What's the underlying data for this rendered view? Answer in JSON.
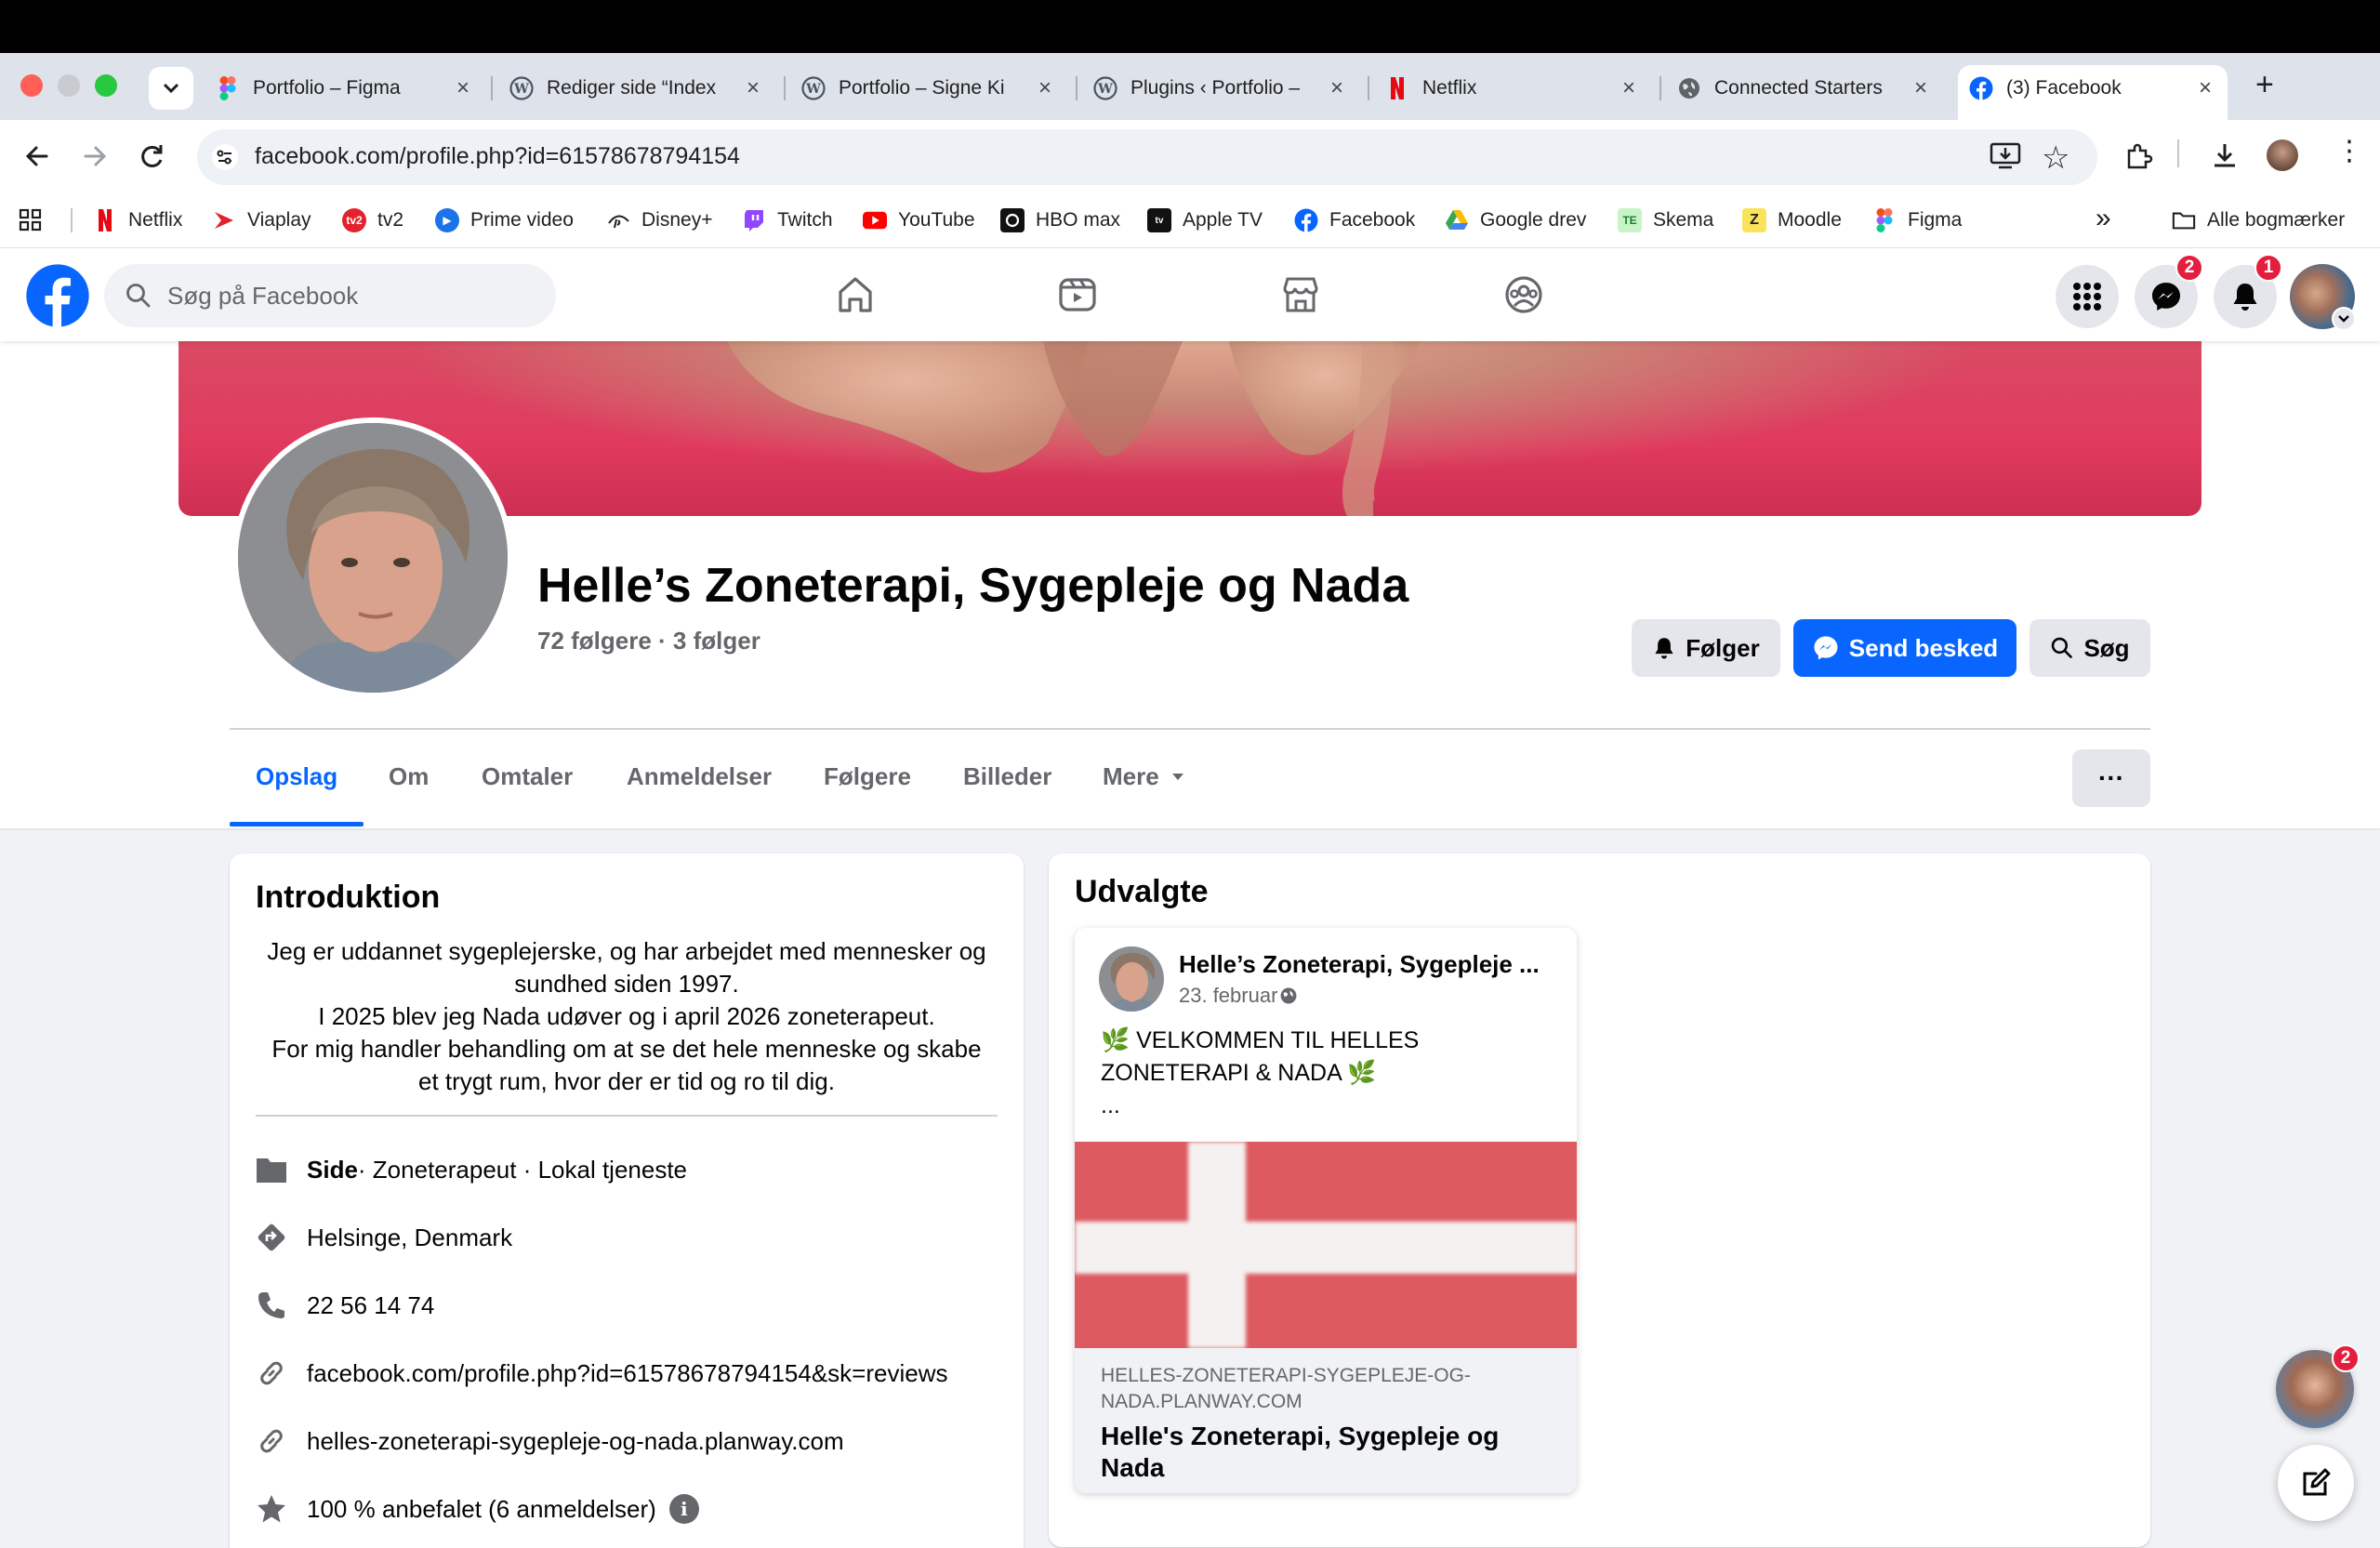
{
  "browser": {
    "tabs": [
      {
        "title": "Portfolio – Figma",
        "icon": "figma-icon"
      },
      {
        "title": "Rediger side “Index",
        "icon": "wordpress-icon"
      },
      {
        "title": "Portfolio – Signe Ki",
        "icon": "wordpress-icon"
      },
      {
        "title": "Plugins ‹ Portfolio –",
        "icon": "wordpress-icon"
      },
      {
        "title": "Netflix",
        "icon": "netflix-icon"
      },
      {
        "title": "Connected Starters",
        "icon": "globe-icon"
      },
      {
        "title": "(3) Facebook",
        "icon": "facebook-icon",
        "active": true
      }
    ],
    "url": "facebook.com/profile.php?id=61578678794154",
    "bookmarks": [
      {
        "label": "Netflix",
        "icon": "netflix-icon"
      },
      {
        "label": "Viaplay",
        "icon": "viaplay-icon"
      },
      {
        "label": "tv2",
        "icon": "tv2-icon"
      },
      {
        "label": "Prime video",
        "icon": "prime-video-icon"
      },
      {
        "label": "Disney+",
        "icon": "disney-icon"
      },
      {
        "label": "Twitch",
        "icon": "twitch-icon"
      },
      {
        "label": "YouTube",
        "icon": "youtube-icon"
      },
      {
        "label": "HBO max",
        "icon": "hbo-icon"
      },
      {
        "label": "Apple TV",
        "icon": "apple-tv-icon"
      },
      {
        "label": "Facebook",
        "icon": "facebook-icon"
      },
      {
        "label": "Google drev",
        "icon": "google-drive-icon"
      },
      {
        "label": "Skema",
        "icon": "skema-icon"
      },
      {
        "label": "Moodle",
        "icon": "moodle-icon"
      },
      {
        "label": "Figma",
        "icon": "figma-icon"
      }
    ],
    "all_bookmarks": "Alle bogmærker",
    "overflow": "»"
  },
  "fb": {
    "search_placeholder": "Søg på Facebook",
    "messenger_badge": "2",
    "notifications_badge": "1",
    "chat_badge": "2",
    "brand_color": "#0866ff"
  },
  "profile": {
    "name": "Helle’s Zoneterapi, Sygepleje og Nada",
    "stats": "72 følgere · 3 følger",
    "buttons": {
      "follow": "Følger",
      "message": "Send besked",
      "search": "Søg"
    },
    "tabs": [
      "Opslag",
      "Om",
      "Omtaler",
      "Anmeldelser",
      "Følgere",
      "Billeder",
      "Mere"
    ],
    "more_menu": "···"
  },
  "intro": {
    "title": "Introduktion",
    "bio_lines": [
      "Jeg er uddannet sygeplejerske, og har arbejdet med mennesker og",
      "sundhed siden 1997.",
      "I 2025 blev jeg Nada udøver og i april 2026 zoneterapeut.",
      "For mig handler behandling om at se det hele menneske og skabe",
      "et trygt rum, hvor der er tid og ro til dig."
    ],
    "page_type_bold": "Side",
    "page_type_rest": " · Zoneterapeut · Lokal tjeneste",
    "location": "Helsinge, Denmark",
    "phone": "22 56 14 74",
    "reviews_link": "facebook.com/profile.php?id=61578678794154&sk=reviews",
    "website": "helles-zoneterapi-sygepleje-og-nada.planway.com",
    "rating": "100 % anbefalet (6 anmeldelser)"
  },
  "featured": {
    "title": "Udvalgte",
    "post": {
      "author": "Helle’s Zoneterapi, Sygepleje ...",
      "date": "23. februar",
      "text_line1": "🌿 VELKOMMEN TIL HELLES",
      "text_line2": "ZONETERAPI & NADA 🌿",
      "ellipsis": "...",
      "link_domain_line1": "HELLES-ZONETERAPI-SYGEPLEJE-OG-",
      "link_domain_line2": "NADA.PLANWAY.COM",
      "link_title_line1": "Helle's Zoneterapi, Sygepleje og",
      "link_title_line2": "Nada"
    }
  }
}
